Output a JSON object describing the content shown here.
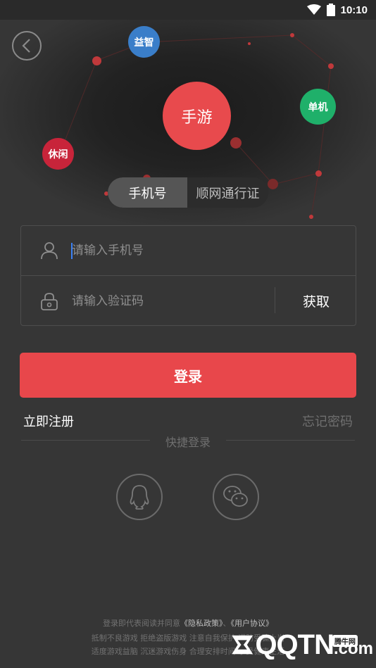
{
  "status_bar": {
    "time": "10:10",
    "icons": [
      "wifi-icon",
      "battery-icon"
    ]
  },
  "bubbles": {
    "yizhi": "益智",
    "shouyou": "手游",
    "danji": "单机",
    "xiuxian": "休闲"
  },
  "tabs": [
    {
      "label": "手机号",
      "active": true
    },
    {
      "label": "顺网通行证",
      "active": false
    }
  ],
  "form": {
    "phone_placeholder": "请输入手机号",
    "code_placeholder": "请输入验证码",
    "get_code_label": "获取"
  },
  "login_label": "登录",
  "register_label": "立即注册",
  "forgot_label": "忘记密码",
  "quick_login_label": "快捷登录",
  "social": [
    "qq-icon",
    "wechat-icon"
  ],
  "footer": {
    "agree_prefix": "登录即代表阅读并同意",
    "privacy_link": "《隐私政策》",
    "separator": "、",
    "user_link": "《用户协议》",
    "line2": "抵制不良游戏 拒绝盗版游戏 注意自我保护 谨防受骗上当",
    "line3": "适度游戏益脑 沉迷游戏伤身 合理安排时间 享受健康生活"
  },
  "watermark": {
    "text": "QQTN",
    "suffix": ".com",
    "badge": "腾牛网"
  },
  "colors": {
    "accent": "#e8474b",
    "background": "#363636",
    "blue": "#3a7ec9",
    "green": "#1fb06a"
  }
}
